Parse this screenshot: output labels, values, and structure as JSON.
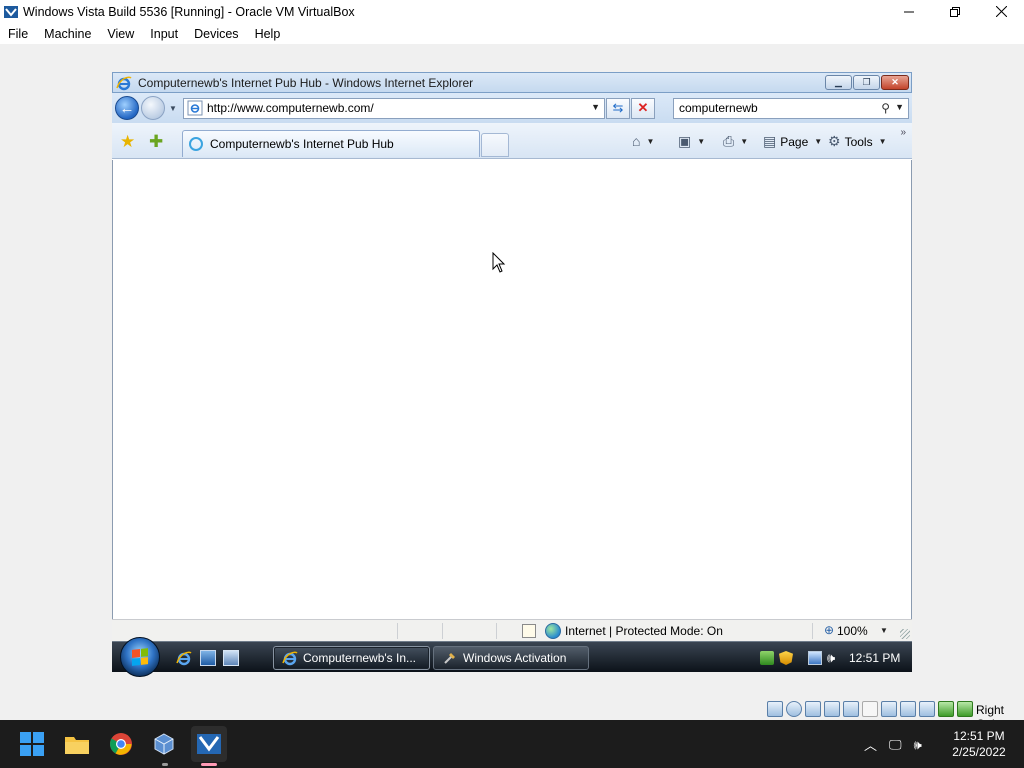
{
  "vbox": {
    "title": "Windows Vista Build 5536 [Running] - Oracle VM VirtualBox",
    "menu": [
      "File",
      "Machine",
      "View",
      "Input",
      "Devices",
      "Help"
    ],
    "host_key": "Right Ctrl"
  },
  "ie": {
    "title": "Computernewb's Internet Pub Hub - Windows Internet Explorer",
    "address": "http://www.computernewb.com/",
    "search_value": "computernewb",
    "tab_label": "Computernewb's Internet Pub Hub",
    "page_label": "Page",
    "tools_label": "Tools",
    "status_text": "Internet | Protected Mode: On",
    "zoom": "100%"
  },
  "vista_taskbar": {
    "buttons": [
      {
        "label": "Computernewb's In..."
      },
      {
        "label": "Windows Activation"
      }
    ],
    "clock": "12:51 PM"
  },
  "host_taskbar": {
    "time": "12:51 PM",
    "date": "2/25/2022"
  },
  "colors": {
    "ie_chrome": "#c9dcf1",
    "vista_taskbar": "#0c1219",
    "win11_taskbar": "#1c1c1c",
    "win11_accent": "#3aa0f3"
  },
  "icons": [
    "virtualbox-icon",
    "ie-icon",
    "back-icon",
    "forward-icon",
    "refresh-icon",
    "stop-icon",
    "search-icon",
    "favorites-star-icon",
    "add-favorites-icon",
    "home-icon",
    "feeds-icon",
    "print-icon",
    "page-icon",
    "tools-gear-icon",
    "globe-icon",
    "zoom-icon",
    "start-orb-icon",
    "windows-start-icon",
    "file-explorer-icon",
    "chrome-icon"
  ]
}
